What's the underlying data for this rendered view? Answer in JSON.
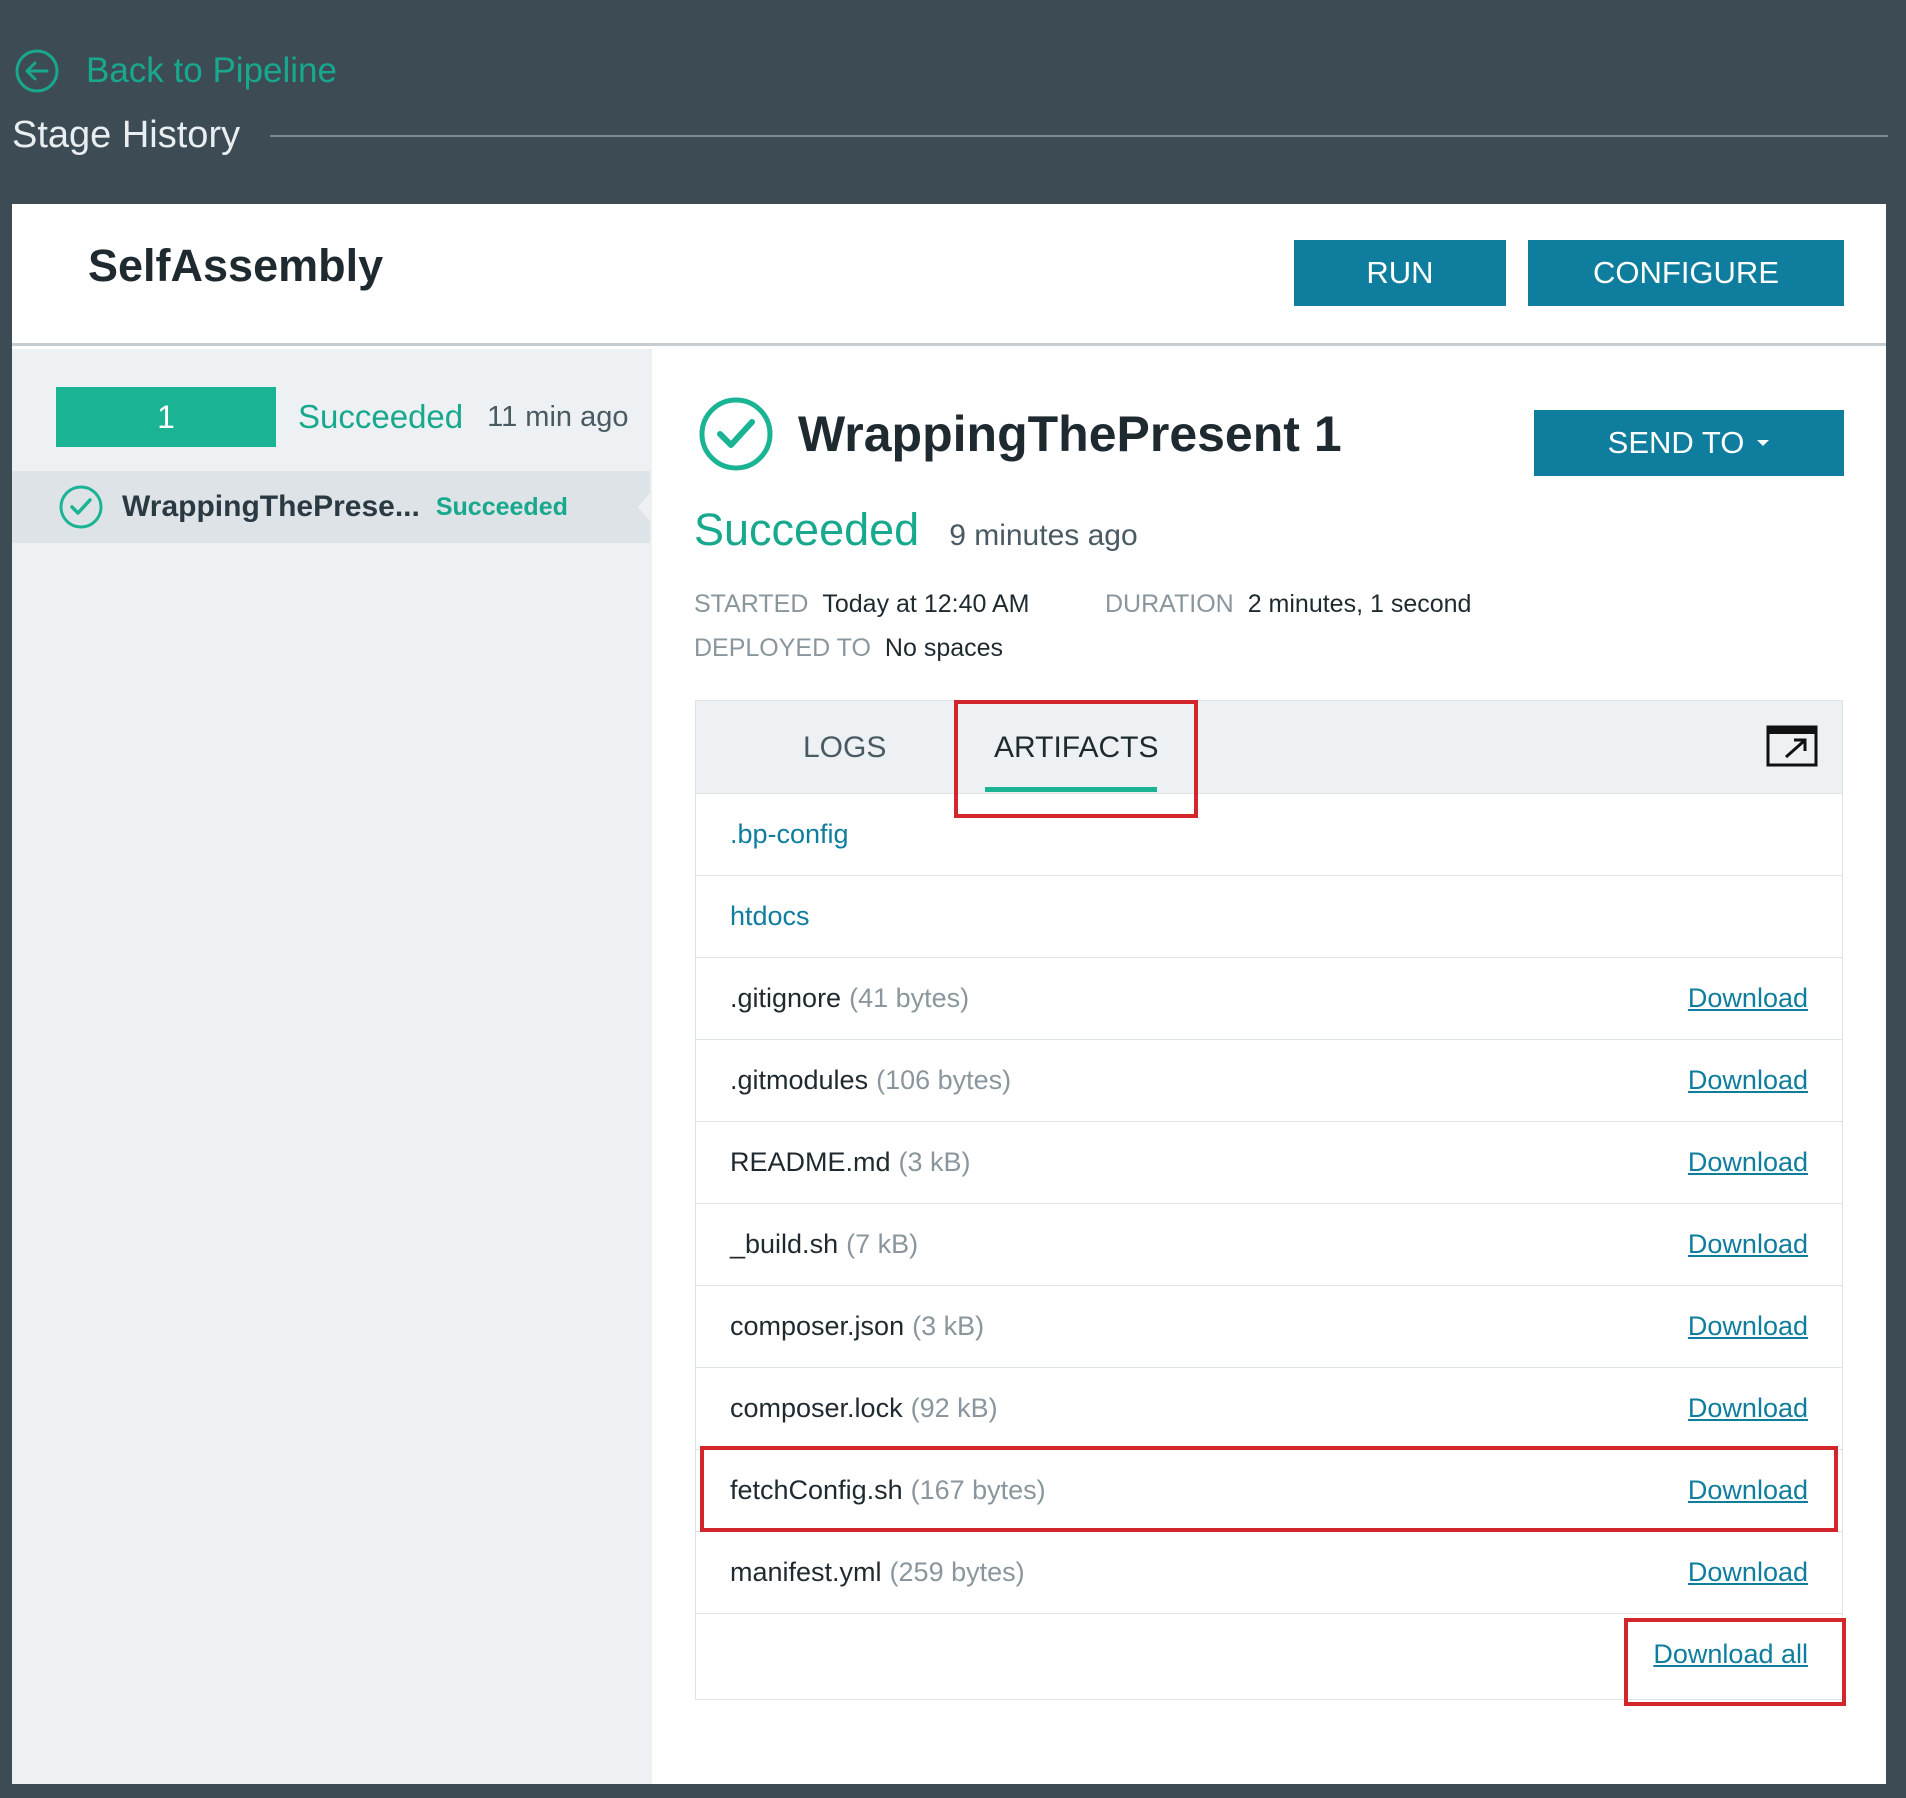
{
  "nav": {
    "back_label": "Back to Pipeline",
    "section_title": "Stage History"
  },
  "stage": {
    "name": "SelfAssembly",
    "run_button": "RUN",
    "configure_button": "CONFIGURE"
  },
  "sidebar": {
    "run_number": "1",
    "run_status": "Succeeded",
    "run_time": "11 min ago",
    "job_name": "WrappingThePrese...",
    "job_status": "Succeeded"
  },
  "job": {
    "title": "WrappingThePresent 1",
    "send_to_button": "SEND TO",
    "status": "Succeeded",
    "ago": "9 minutes ago",
    "started_label": "STARTED",
    "started_value": "Today at 12:40 AM",
    "duration_label": "DURATION",
    "duration_value": "2 minutes, 1 second",
    "deployed_label": "DEPLOYED TO",
    "deployed_value": "No spaces"
  },
  "tabs": {
    "logs": "LOGS",
    "artifacts": "ARTIFACTS"
  },
  "artifacts": {
    "folders": [
      ".bp-config",
      "htdocs"
    ],
    "files": [
      {
        "name": ".gitignore",
        "size": "(41 bytes)",
        "action": "Download"
      },
      {
        "name": ".gitmodules",
        "size": "(106 bytes)",
        "action": "Download"
      },
      {
        "name": "README.md",
        "size": "(3 kB)",
        "action": "Download"
      },
      {
        "name": "_build.sh",
        "size": "(7 kB)",
        "action": "Download"
      },
      {
        "name": "composer.json",
        "size": "(3 kB)",
        "action": "Download"
      },
      {
        "name": "composer.lock",
        "size": "(92 kB)",
        "action": "Download"
      },
      {
        "name": "fetchConfig.sh",
        "size": "(167 bytes)",
        "action": "Download"
      },
      {
        "name": "manifest.yml",
        "size": "(259 bytes)",
        "action": "Download"
      }
    ],
    "download_all": "Download all"
  },
  "colors": {
    "accent": "#1ab394",
    "primary_button": "#0f7d9e",
    "highlight_box": "#d0262c",
    "background": "#3d4b54"
  }
}
